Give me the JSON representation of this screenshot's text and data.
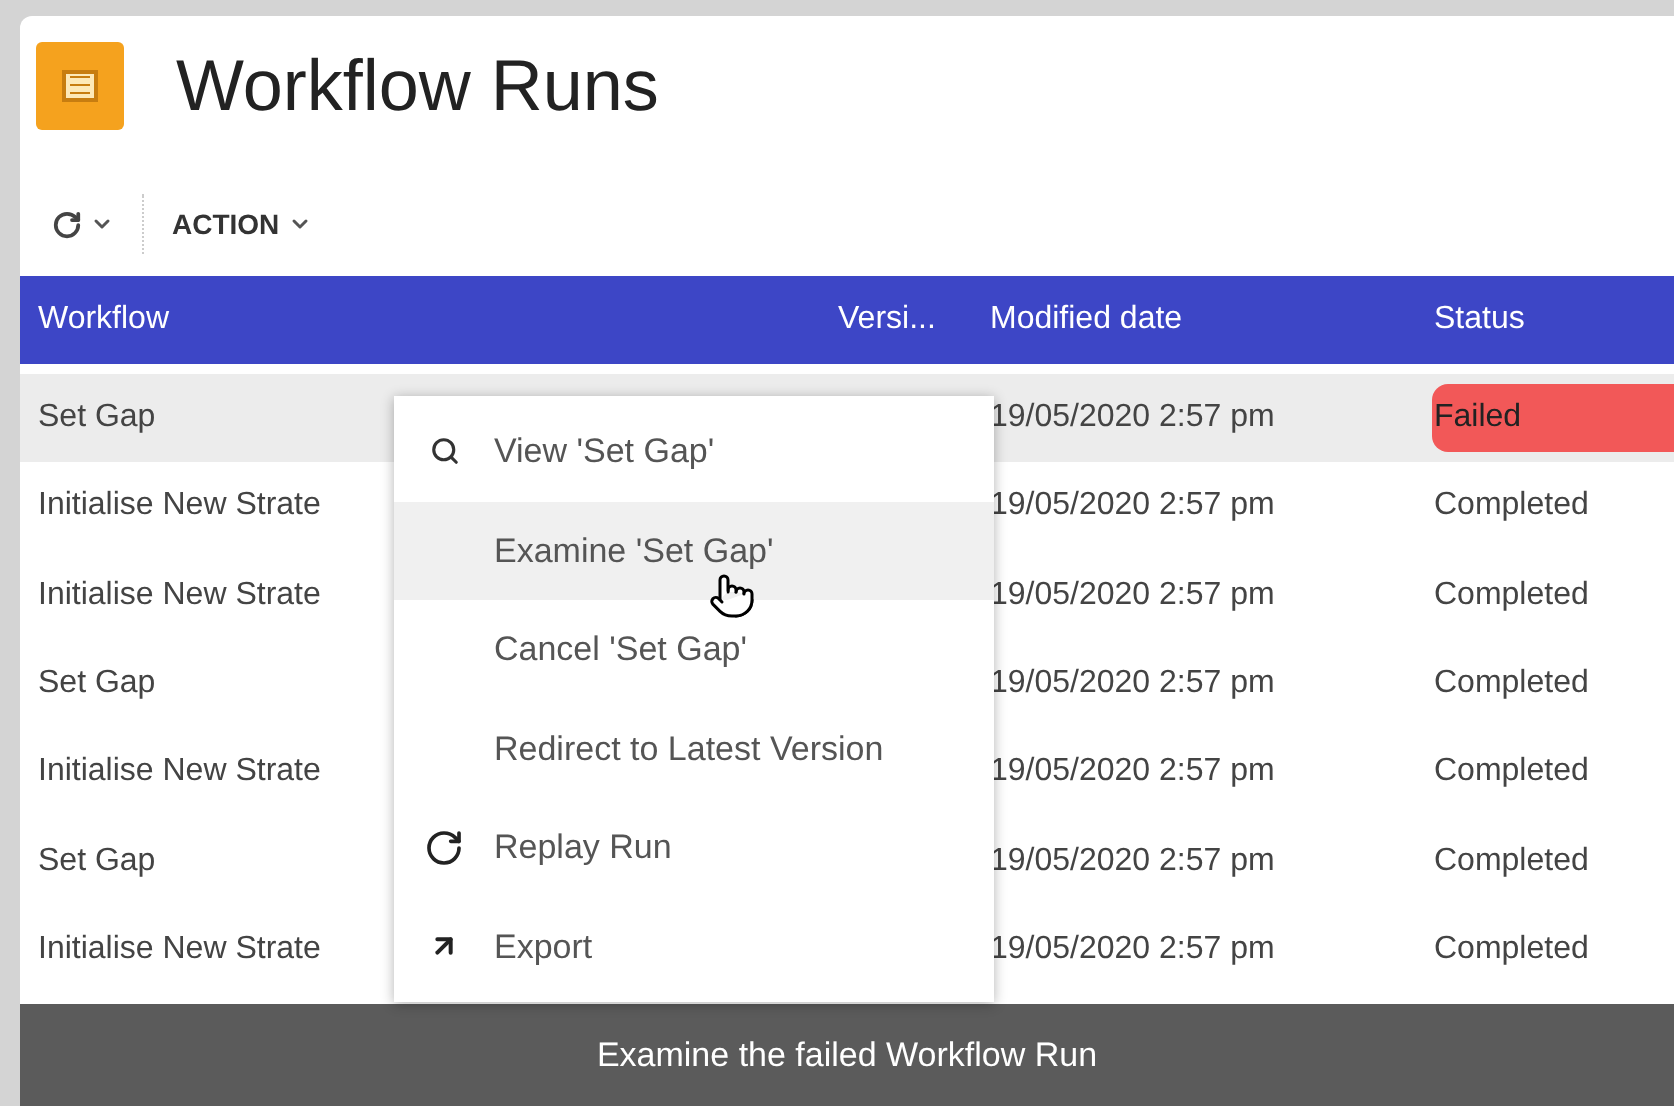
{
  "header": {
    "title": "Workflow Runs"
  },
  "toolbar": {
    "action_label": "ACTION"
  },
  "table": {
    "columns": [
      "Workflow",
      "Versi...",
      "Modified date",
      "Status"
    ],
    "rows": [
      {
        "workflow": "Set Gap",
        "modified": "19/05/2020 2:57 pm",
        "status": "Failed",
        "kind": "failed",
        "selected": true
      },
      {
        "workflow": "Initialise New Strate",
        "modified": "19/05/2020 2:57 pm",
        "status": "Completed",
        "kind": "completed",
        "selected": false
      },
      {
        "workflow": "Initialise New Strate",
        "modified": "19/05/2020 2:57 pm",
        "status": "Completed",
        "kind": "completed",
        "selected": false
      },
      {
        "workflow": "Set Gap",
        "modified": "19/05/2020 2:57 pm",
        "status": "Completed",
        "kind": "completed",
        "selected": false
      },
      {
        "workflow": "Initialise New Strate",
        "modified": "19/05/2020 2:57 pm",
        "status": "Completed",
        "kind": "completed",
        "selected": false
      },
      {
        "workflow": "Set Gap",
        "modified": "19/05/2020 2:57 pm",
        "status": "Completed",
        "kind": "completed",
        "selected": false
      },
      {
        "workflow": "Initialise New Strate",
        "modified": "19/05/2020 2:57 pm",
        "status": "Completed",
        "kind": "completed",
        "selected": false
      }
    ]
  },
  "context_menu": {
    "items": [
      {
        "label": "View 'Set Gap'",
        "kind": "search",
        "selected": false
      },
      {
        "label": "Examine 'Set Gap'",
        "kind": "plain",
        "selected": true
      },
      {
        "label": "Cancel 'Set Gap'",
        "kind": "plain",
        "selected": false
      },
      {
        "label": "Redirect to Latest Version",
        "kind": "plain",
        "selected": false
      },
      {
        "label": "Replay Run",
        "kind": "replay",
        "selected": false
      },
      {
        "label": "Export",
        "kind": "export",
        "selected": false
      }
    ]
  },
  "caption": "Examine the failed Workflow Run"
}
